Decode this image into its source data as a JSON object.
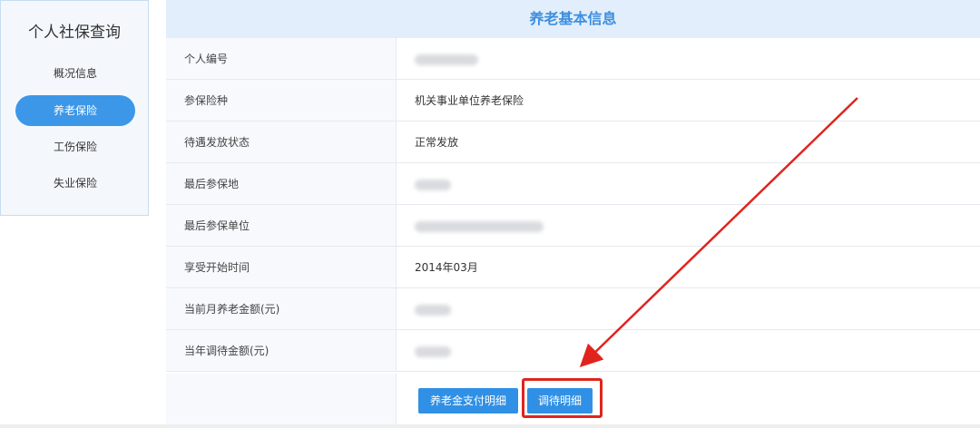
{
  "sidebar": {
    "title": "个人社保查询",
    "items": [
      {
        "label": "概况信息",
        "active": false
      },
      {
        "label": "养老保险",
        "active": true
      },
      {
        "label": "工伤保险",
        "active": false
      },
      {
        "label": "失业保险",
        "active": false
      }
    ]
  },
  "main": {
    "title": "养老基本信息",
    "rows": [
      {
        "label": "个人编号",
        "value": ""
      },
      {
        "label": "参保险种",
        "value": "机关事业单位养老保险"
      },
      {
        "label": "待遇发放状态",
        "value": "正常发放"
      },
      {
        "label": "最后参保地",
        "value": ""
      },
      {
        "label": "最后参保单位",
        "value": ""
      },
      {
        "label": "享受开始时间",
        "value": "2014年03月"
      },
      {
        "label": "当前月养老金额(元)",
        "value": ""
      },
      {
        "label": "当年调待金额(元)",
        "value": ""
      }
    ],
    "buttons": {
      "payment_detail": "养老金支付明细",
      "adjust_detail": "调待明细"
    }
  },
  "annotation": {
    "color": "#e0241d"
  }
}
